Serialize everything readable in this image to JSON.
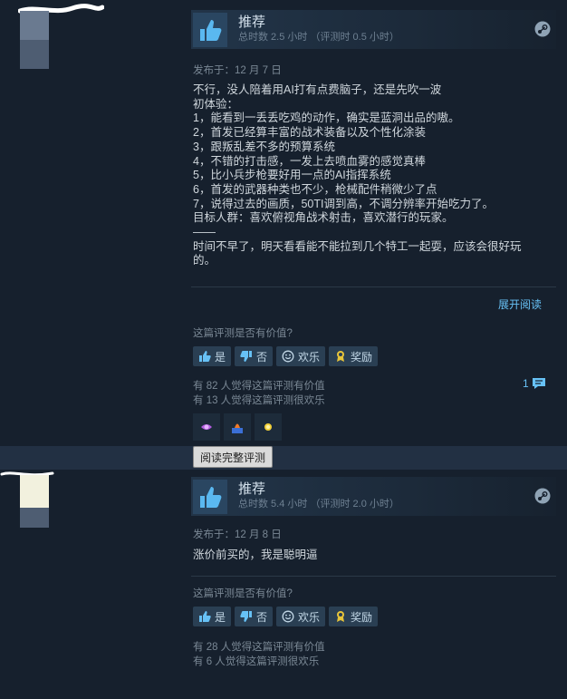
{
  "reviews": [
    {
      "recommendation": "推荐",
      "hours": "总时数 2.5 小时  （评测时 0.5 小时）",
      "posted": "发布于：12 月 7 日",
      "lines": [
        "不行，没人陪着用AI打有点费脑子，还是先吹一波",
        "初体验：",
        "1，能看到一丢丢吃鸡的动作，确实是蓝洞出品的嗷。",
        "2，首发已经算丰富的战术装备以及个性化涂装",
        "3，跟叛乱差不多的预算系统",
        "4，不错的打击感，一发上去喷血雾的感觉真棒",
        "5，比小兵步枪要好用一点的AI指挥系统",
        "6，首发的武器种类也不少，枪械配件稍微少了点",
        "7，说得过去的画质，50TI调到高，不调分辨率开始吃力了。",
        "目标人群：喜欢俯视角战术射击，喜欢潜行的玩家。",
        "——",
        "时间不早了，明天看看能不能拉到几个特工一起耍，应该会很好玩",
        "的。"
      ],
      "expand": "展开阅读",
      "helpful_question": "这篇评测是否有价值?",
      "buttons": {
        "yes": "是",
        "no": "否",
        "funny": "欢乐",
        "award": "奖励"
      },
      "helpful_count": "有 82 人觉得这篇评测有价值",
      "funny_count": "有 13 人觉得这篇评测很欢乐",
      "comments": "1",
      "tooltip": "阅读完整评测"
    },
    {
      "recommendation": "推荐",
      "hours": "总时数 5.4 小时  （评测时 2.0 小时）",
      "posted": "发布于：12 月 8 日",
      "text": "涨价前买的，我是聪明逼",
      "helpful_question": "这篇评测是否有价值?",
      "buttons": {
        "yes": "是",
        "no": "否",
        "funny": "欢乐",
        "award": "奖励"
      },
      "helpful_count": "有 28 人觉得这篇评测有价值",
      "funny_count": "有 6 人觉得这篇评测很欢乐"
    }
  ],
  "colors": {
    "background": "#1b2838",
    "panel": "#16202d",
    "link": "#67c1f5",
    "button": "#2a3f53"
  }
}
